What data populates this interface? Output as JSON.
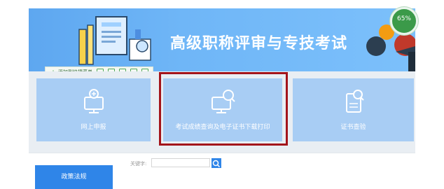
{
  "banner": {
    "title": "高级职称评审与专技考试",
    "badge_text": "65%"
  },
  "toolbar": {
    "add_label": "添加到快捷菜单"
  },
  "cards": [
    {
      "label": "网上申报",
      "icon": "monitor-plus-icon"
    },
    {
      "label": "考试成绩查询及电子证书下载打印",
      "icon": "monitor-search-icon"
    },
    {
      "label": "证书查验",
      "icon": "document-search-icon"
    }
  ],
  "search": {
    "keyword_label": "关键字:",
    "value": ""
  },
  "sidebar": {
    "button_label": "政策法规"
  },
  "colors": {
    "banner": "#6fb6f7",
    "card": "#a8cdf4",
    "highlight": "#a3141b",
    "primary": "#2f85e8",
    "badge": "#3b9a49"
  }
}
